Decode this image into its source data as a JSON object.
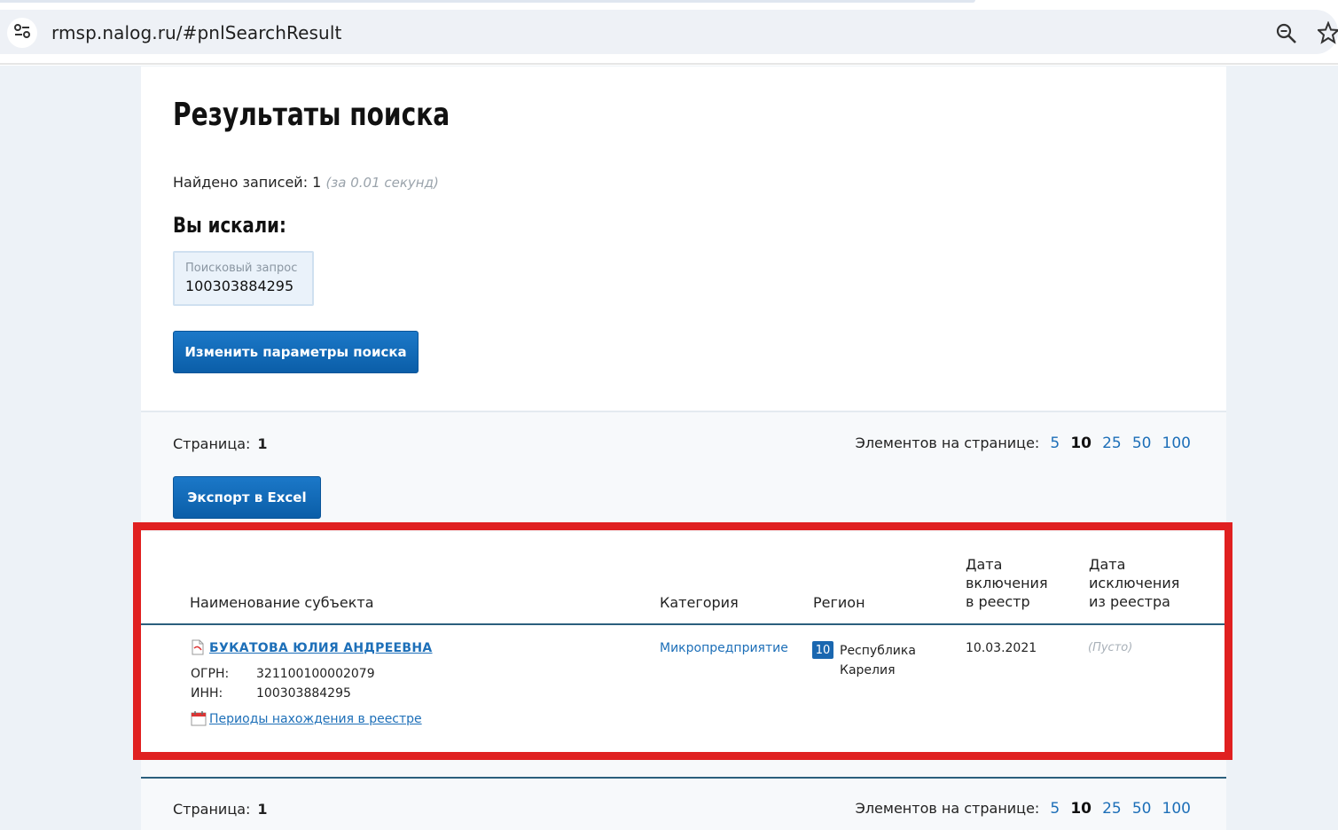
{
  "browser": {
    "url": "rmsp.nalog.ru/#pnlSearchResult"
  },
  "page": {
    "title": "Результаты поиска",
    "found_label": "Найдено записей: 1",
    "found_time": "(за 0.01 секунд)",
    "you_searched": "Вы искали:",
    "query": {
      "label": "Поисковый запрос",
      "value": "100303884295"
    },
    "change_button": "Изменить параметры поиска"
  },
  "pager": {
    "page_label": "Страница:",
    "page_number": "1",
    "per_page_label": "Элементов на странице:",
    "options": [
      "5",
      "10",
      "25",
      "50",
      "100"
    ],
    "selected": "10"
  },
  "export_button": "Экспорт в Excel",
  "table": {
    "headers": {
      "name": "Наименование субъекта",
      "category": "Категория",
      "region": "Регион",
      "date_in": [
        "Дата",
        "включения",
        "в реестр"
      ],
      "date_out": [
        "Дата",
        "исключения",
        "из реестра"
      ]
    },
    "row": {
      "name": "БУКАТОВА ЮЛИЯ АНДРЕЕВНА",
      "ogrn_label": "ОГРН:",
      "ogrn": "321100100002079",
      "inn_label": "ИНН:",
      "inn": "100303884295",
      "periods_link": "Периоды нахождения в реестре",
      "category": "Микропредприятие",
      "region_code": "10",
      "region_line1": "Республика",
      "region_line2": "Карелия",
      "date_in": "10.03.2021",
      "date_out": "(Пусто)"
    }
  },
  "colors": {
    "accent": "#1d6fb8",
    "button": "#0b5ea8",
    "highlight": "#e02020"
  }
}
